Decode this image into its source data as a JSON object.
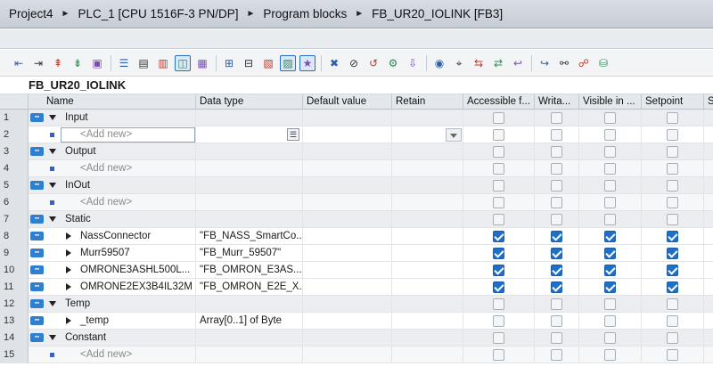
{
  "breadcrumb": [
    "Project4",
    "PLC_1 [CPU 1516F-3 PN/DP]",
    "Program blocks",
    "FB_UR20_IOLINK [FB3]"
  ],
  "toolbar": {
    "icons": [
      "insert-row-icon",
      "add-row-icon",
      "insert-above-icon",
      "insert-below-icon",
      "monitor-icon",
      "indent-icon",
      "list-icon",
      "details-icon",
      "comment-icon",
      "expand-icon",
      "tag-icon",
      "refresh-icon",
      "sort-icon",
      "view-icon",
      "favorites-icon",
      "delete-icon",
      "clear-icon",
      "reset-icon",
      "compile-icon",
      "download-icon",
      "watch-icon",
      "snapshot-icon",
      "compare-icon",
      "compare-2-icon",
      "arrow-icon",
      "connect-icon",
      "glasses-icon",
      "monitor-on-icon",
      "database-icon"
    ]
  },
  "block_name": "FB_UR20_IOLINK",
  "columns": [
    "Name",
    "Data type",
    "Default value",
    "Retain",
    "Accessible f...",
    "Writa...",
    "Visible in ...",
    "Setpoint",
    "S"
  ],
  "rows": [
    {
      "num": "1",
      "kind": "section",
      "name": "Input"
    },
    {
      "num": "2",
      "kind": "add",
      "name": "<Add new>",
      "active": true
    },
    {
      "num": "3",
      "kind": "section",
      "name": "Output"
    },
    {
      "num": "4",
      "kind": "add",
      "name": "<Add new>"
    },
    {
      "num": "5",
      "kind": "section",
      "name": "InOut"
    },
    {
      "num": "6",
      "kind": "add",
      "name": "<Add new>"
    },
    {
      "num": "7",
      "kind": "section",
      "name": "Static"
    },
    {
      "num": "8",
      "kind": "member",
      "name": "NassConnector",
      "type": "\"FB_NASS_SmartCo...",
      "checks": [
        true,
        true,
        true,
        true
      ]
    },
    {
      "num": "9",
      "kind": "member",
      "name": "Murr59507",
      "type": "\"FB_Murr_59507\"",
      "checks": [
        true,
        true,
        true,
        true
      ]
    },
    {
      "num": "10",
      "kind": "member",
      "name": "OMRONE3ASHL500L...",
      "type": "\"FB_OMRON_E3AS...",
      "checks": [
        true,
        true,
        true,
        true
      ]
    },
    {
      "num": "11",
      "kind": "member",
      "name": "OMRONE2EX3B4IL32M",
      "type": "\"FB_OMRON_E2E_X...",
      "checks": [
        true,
        true,
        true,
        true
      ]
    },
    {
      "num": "12",
      "kind": "section",
      "name": "Temp"
    },
    {
      "num": "13",
      "kind": "member",
      "name": "_temp",
      "type": "Array[0..1] of Byte",
      "checks": null
    },
    {
      "num": "14",
      "kind": "section",
      "name": "Constant"
    },
    {
      "num": "15",
      "kind": "add",
      "name": "<Add new>"
    }
  ]
}
